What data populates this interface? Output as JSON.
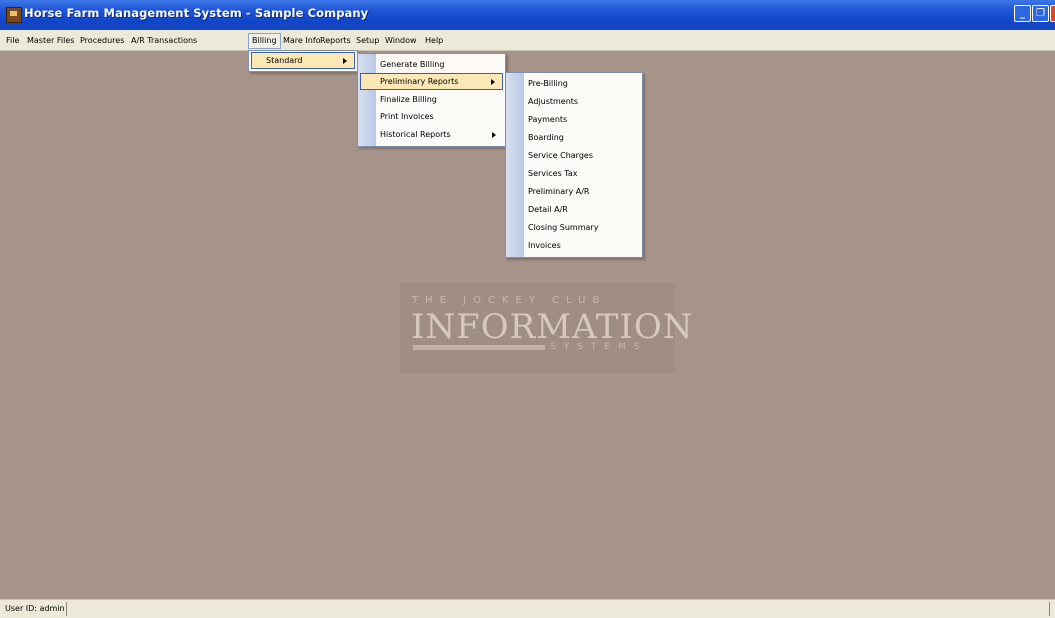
{
  "window": {
    "title": "Horse Farm Management System - Sample Company",
    "minimize_icon": "minimize-icon",
    "restore_icon": "restore-icon",
    "close_icon": "close-icon"
  },
  "menubar": {
    "items": [
      "File",
      "Master Files",
      "Procedures",
      "A/R Transactions",
      "Billing",
      "Mare Info",
      "Reports",
      "Setup",
      "Window",
      "Help"
    ],
    "active": "Billing"
  },
  "billing_menu": {
    "items": [
      {
        "label": "Standard",
        "has_submenu": true
      }
    ]
  },
  "standard_menu": {
    "items": [
      {
        "label": "Generate Billing",
        "has_submenu": false
      },
      {
        "label": "Preliminary Reports",
        "has_submenu": true
      },
      {
        "label": "Finalize Billing",
        "has_submenu": false
      },
      {
        "label": "Print Invoices",
        "has_submenu": false
      },
      {
        "label": "Historical Reports",
        "has_submenu": true
      }
    ]
  },
  "preliminary_menu": {
    "items": [
      {
        "label": "Pre-Billing"
      },
      {
        "label": "Adjustments"
      },
      {
        "label": "Payments"
      },
      {
        "label": "Boarding"
      },
      {
        "label": "Service Charges"
      },
      {
        "label": "Services Tax"
      },
      {
        "label": "Preliminary A/R"
      },
      {
        "label": "Detail A/R"
      },
      {
        "label": "Closing Summary"
      },
      {
        "label": "Invoices"
      }
    ]
  },
  "logo": {
    "top": "THE JOCKEY CLUB",
    "main": "INFORMATION",
    "sub": "SYSTEMS"
  },
  "statusbar": {
    "user": "User ID: admin"
  },
  "colors": {
    "desktop": "#a6948a",
    "titlebar": "#0f45c9",
    "menu_highlight": "#fbe8b4"
  }
}
